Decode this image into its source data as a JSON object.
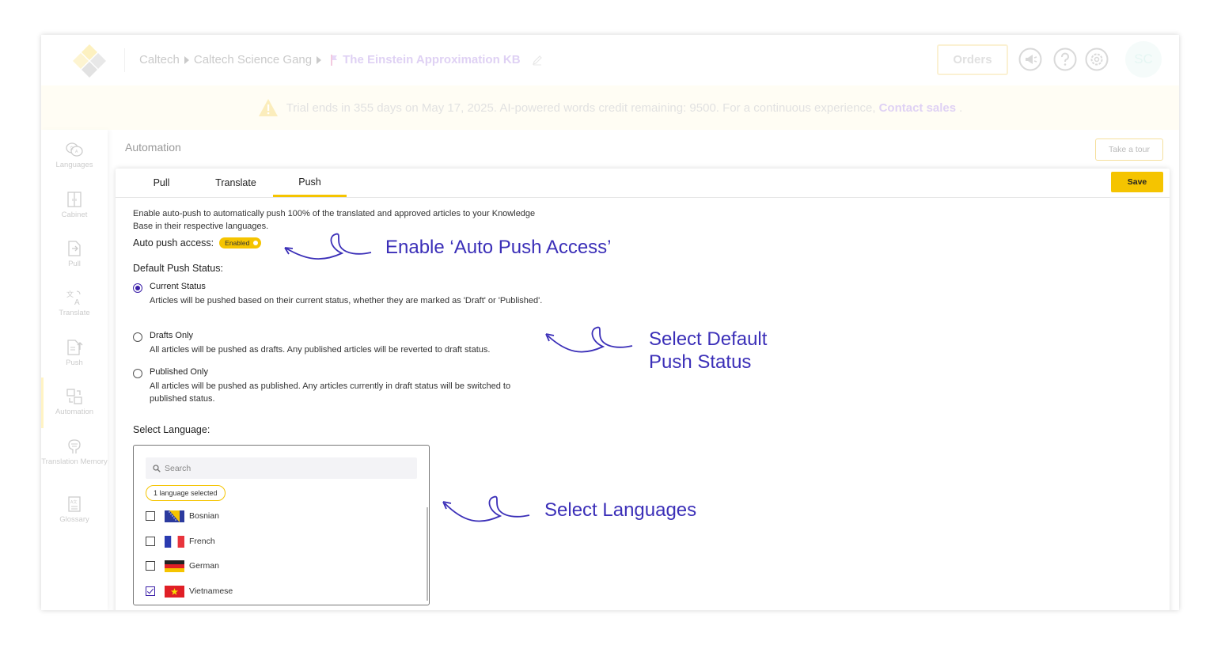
{
  "header": {
    "breadcrumb": [
      "Caltech",
      "Caltech Science Gang"
    ],
    "kb_name": "The Einstein Approximation KB",
    "orders_label": "Orders",
    "avatar_initials": "SC",
    "icons": [
      "megaphone-icon",
      "help-icon",
      "settings-icon"
    ]
  },
  "banner": {
    "text": "Trial ends in 355 days on May 17, 2025. AI-powered words credit remaining: 9500. For a continuous experience,",
    "link": "Contact sales",
    "tail": "."
  },
  "sidebar": {
    "items": [
      {
        "label": "Languages",
        "icon": "languages-icon"
      },
      {
        "label": "Cabinet",
        "icon": "cabinet-icon"
      },
      {
        "label": "Pull",
        "icon": "pull-icon"
      },
      {
        "label": "Translate",
        "icon": "translate-icon"
      },
      {
        "label": "Push",
        "icon": "push-icon"
      },
      {
        "label": "Automation",
        "icon": "automation-icon"
      },
      {
        "label": "Translation Memory",
        "icon": "translation-memory-icon"
      },
      {
        "label": "Glossary",
        "icon": "glossary-icon"
      }
    ],
    "active": "Automation"
  },
  "page": {
    "title": "Automation",
    "tour_label": "Take a tour"
  },
  "tabs": {
    "items": [
      "Pull",
      "Translate",
      "Push"
    ],
    "active": "Push",
    "save_label": "Save"
  },
  "push": {
    "description": "Enable auto-push to automatically push 100% of the translated and approved articles to your Knowledge Base in their respective languages.",
    "auto_push_label": "Auto push access:",
    "auto_push_state": "Enabled",
    "default_status_label": "Default Push Status:",
    "options": [
      {
        "title": "Current Status",
        "desc": "Articles will be pushed based on their current status, whether they are marked as 'Draft' or 'Published'.",
        "selected": true
      },
      {
        "title": "Drafts Only",
        "desc": "All articles will be pushed as drafts. Any published articles will be reverted to draft status.",
        "selected": false
      },
      {
        "title": "Published Only",
        "desc": "All articles will be pushed as published. Any articles currently in draft status will be switched to published status.",
        "selected": false
      }
    ],
    "select_language_label": "Select Language:",
    "search_placeholder": "Search",
    "selected_count": "1 language selected",
    "languages": [
      {
        "name": "Bosnian",
        "checked": false
      },
      {
        "name": "French",
        "checked": false
      },
      {
        "name": "German",
        "checked": false
      },
      {
        "name": "Vietnamese",
        "checked": true
      }
    ]
  },
  "annotations": {
    "a1": "Enable ‘Auto Push Access’",
    "a2_line1": "Select Default",
    "a2_line2": "Push Status",
    "a3": "Select Languages",
    "color": "#3b2fb8"
  },
  "colors": {
    "accent": "#f5c400",
    "primary": "#3b1fa8",
    "link": "#b89ae6",
    "banner_bg": "#fffbe6"
  }
}
